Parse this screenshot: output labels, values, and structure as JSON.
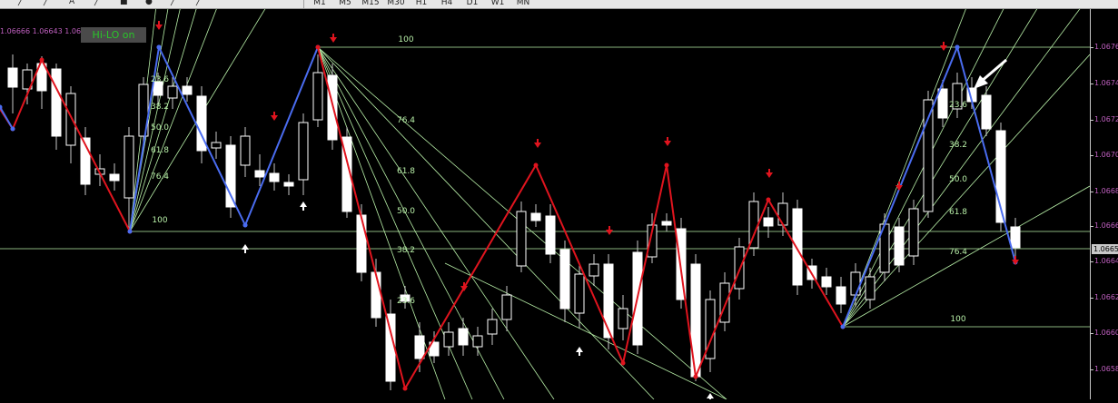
{
  "toolbar": {
    "drawing_tools": [
      "trendline-icon",
      "fibo-icon",
      "text-icon",
      "label-icon",
      "rectangle-icon",
      "ellipse-icon",
      "fibo-fan-icon",
      "arrows-icon"
    ],
    "drawing_labels": {
      "text": "A"
    },
    "timeframes": [
      "M1",
      "M5",
      "M15",
      "M30",
      "H1",
      "H4",
      "D1",
      "W1",
      "MN"
    ]
  },
  "indicator": {
    "ohlc_text": "1.06666 1.06643 1.066",
    "hilo_button": "Hi-LO on",
    "hilo_color": "#29c629"
  },
  "price_scale": {
    "labels": [
      "1.06760",
      "1.06740",
      "1.06720",
      "1.06700",
      "1.06680",
      "1.06660",
      "1.06640",
      "1.06620",
      "1.06600",
      "1.06580"
    ],
    "current_price": "1.06650",
    "label_color": "#c060c0"
  },
  "colors": {
    "zigzag_up": "#4a6cf0",
    "zigzag_down": "#e0141e",
    "fib_line": "#b8f0a8",
    "fib_text": "#b8f0a8",
    "arrow_down": "#e0141e",
    "arrow_up": "#ffffff",
    "candle_bull": "#ffffff",
    "candle_bear": "#ffffff"
  },
  "fib_levels": [
    "100",
    "76.4",
    "61.8",
    "50.0",
    "38.2",
    "23.6"
  ],
  "fib_labels": {
    "left": [
      "100",
      "76.4",
      "61.8",
      "50.0",
      "38.2",
      "23.6"
    ],
    "middle_top": "100",
    "middle": [
      "76.4",
      "61.8",
      "50.0",
      "38.2",
      "23.6"
    ],
    "right": [
      "23.6",
      "38.2",
      "50.0",
      "61.8",
      "76.4"
    ],
    "right_bottom": "100"
  },
  "chart_data": {
    "type": "candlestick",
    "y_axis_labels": [
      "1.06760",
      "1.06740",
      "1.06720",
      "1.06700",
      "1.06680",
      "1.06660",
      "1.06640",
      "1.06620",
      "1.06600",
      "1.06580"
    ],
    "current_price": "1.06650",
    "zigzag_pivots": [
      1.06708,
      1.06746,
      1.06662,
      1.0676,
      1.06658,
      1.06752,
      1.06592,
      1.06686,
      1.06595,
      1.06684,
      1.0659,
      1.06676,
      1.06618,
      1.06752,
      1.06645
    ],
    "signal_arrows": {
      "down": 11,
      "up": 4
    },
    "ylim": [
      1.0657,
      1.0678
    ]
  }
}
